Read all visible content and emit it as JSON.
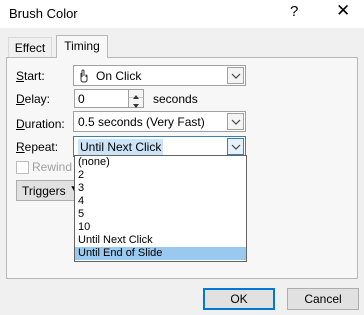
{
  "window": {
    "title": "Brush Color",
    "help_glyph": "?",
    "close_glyph": "✕"
  },
  "tabs": [
    {
      "label": "Effect",
      "active": false
    },
    {
      "label": "Timing",
      "active": true
    }
  ],
  "timing": {
    "start": {
      "label_prefix": "S",
      "label_rest": "tart:",
      "value": "On Click",
      "icon": "mouse-click-icon"
    },
    "delay": {
      "label_prefix": "D",
      "label_rest": "elay:",
      "value": "0",
      "unit": "seconds"
    },
    "duration": {
      "label_prefix": "D",
      "label_rest": "uration:",
      "value": "0.5 seconds (Very Fast)"
    },
    "repeat": {
      "label_prefix": "R",
      "label_rest": "epeat:",
      "value": "Until Next Click"
    },
    "rewind": {
      "label": "Rewind",
      "checked": false,
      "enabled": false
    },
    "triggers": {
      "label": "Triggers",
      "arrow_glyph": "⯆"
    }
  },
  "repeat_options": [
    {
      "label": "(none)",
      "selected": false
    },
    {
      "label": "2",
      "selected": false
    },
    {
      "label": "3",
      "selected": false
    },
    {
      "label": "4",
      "selected": false
    },
    {
      "label": "5",
      "selected": false
    },
    {
      "label": "10",
      "selected": false
    },
    {
      "label": "Until Next Click",
      "selected": false
    },
    {
      "label": "Until End of Slide",
      "selected": true
    }
  ],
  "buttons": {
    "ok": "OK",
    "cancel": "Cancel"
  },
  "colors": {
    "focus_border": "#0078d7",
    "list_highlight": "#99c9ef",
    "selected_text_bg": "#cce4f7"
  }
}
